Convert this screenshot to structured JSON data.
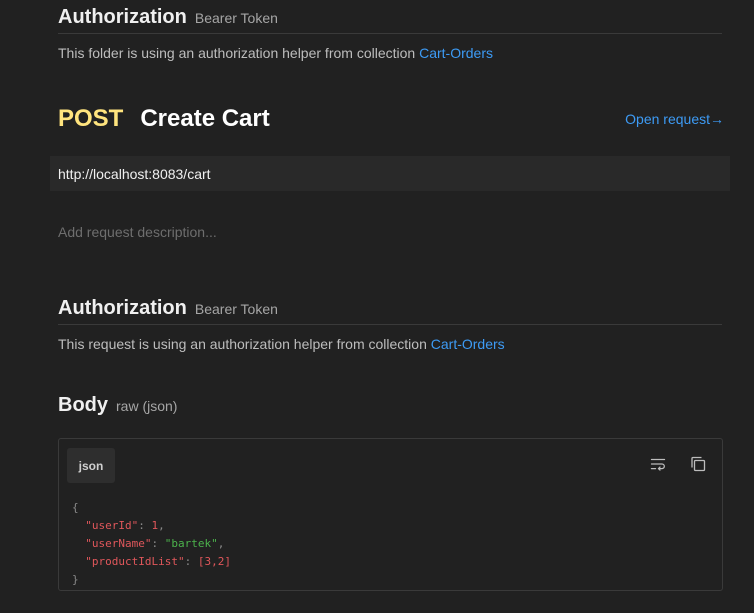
{
  "folder_auth": {
    "title": "Authorization",
    "type": "Bearer Token",
    "helper_text": "This folder is using an authorization helper from collection",
    "collection": "Cart-Orders"
  },
  "request": {
    "method": "POST",
    "name": "Create Cart",
    "open_label": "Open request",
    "open_arrow": "→",
    "url": "http://localhost:8083/cart",
    "description_placeholder": "Add request description..."
  },
  "request_auth": {
    "title": "Authorization",
    "type": "Bearer Token",
    "helper_text": "This request is using an authorization helper from collection",
    "collection": "Cart-Orders"
  },
  "body": {
    "title": "Body",
    "mode": "raw (json)",
    "language": "json",
    "code": {
      "open": "{",
      "close": "}",
      "fields": [
        {
          "key": "\"userId\"",
          "value": "1",
          "value_type": "num",
          "trail": ","
        },
        {
          "key": "\"userName\"",
          "value": "\"bartek\"",
          "value_type": "str",
          "trail": ","
        },
        {
          "key": "\"productIdList\"",
          "value": "[3,2]",
          "value_type": "num",
          "trail": ""
        }
      ]
    }
  },
  "icons": {
    "wrap": "wrap-lines-icon",
    "copy": "copy-icon"
  },
  "colors": {
    "background": "#212121",
    "method_post": "#ffe47e",
    "link": "#3d9bf5"
  }
}
